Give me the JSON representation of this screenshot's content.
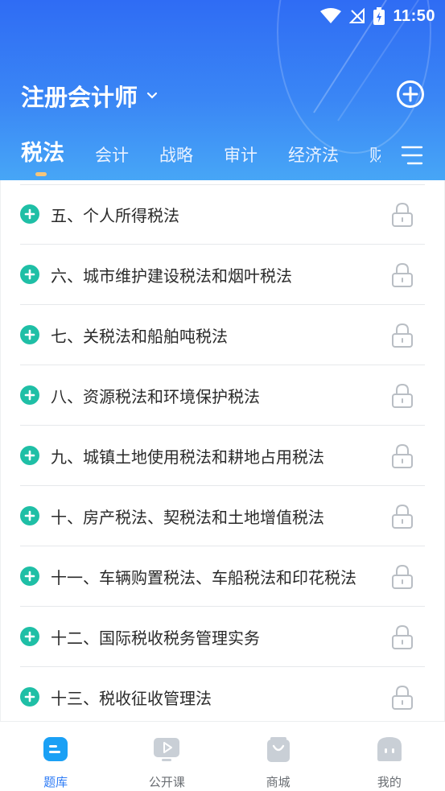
{
  "status_bar": {
    "time": "11:50"
  },
  "header": {
    "title": "注册会计师"
  },
  "tabs": [
    {
      "label": "税法"
    },
    {
      "label": "会计"
    },
    {
      "label": "战略"
    },
    {
      "label": "审计"
    },
    {
      "label": "经济法"
    },
    {
      "label": "财"
    }
  ],
  "list": {
    "items": [
      {
        "label": "五、个人所得税法"
      },
      {
        "label": "六、城市维护建设税法和烟叶税法"
      },
      {
        "label": "七、关税法和船舶吨税法"
      },
      {
        "label": "八、资源税法和环境保护税法"
      },
      {
        "label": "九、城镇土地使用税法和耕地占用税法"
      },
      {
        "label": "十、房产税法、契税法和土地增值税法"
      },
      {
        "label": "十一、车辆购置税法、车船税法和印花税法"
      },
      {
        "label": "十二、国际税收税务管理实务"
      },
      {
        "label": "十三、税收征收管理法"
      }
    ]
  },
  "bottom_nav": [
    {
      "label": "题库"
    },
    {
      "label": "公开课"
    },
    {
      "label": "商城"
    },
    {
      "label": "我的"
    }
  ],
  "colors": {
    "accent": "#2f7cf6",
    "plus": "#1fbfa6",
    "tab_indicator": "#f6c57a"
  }
}
